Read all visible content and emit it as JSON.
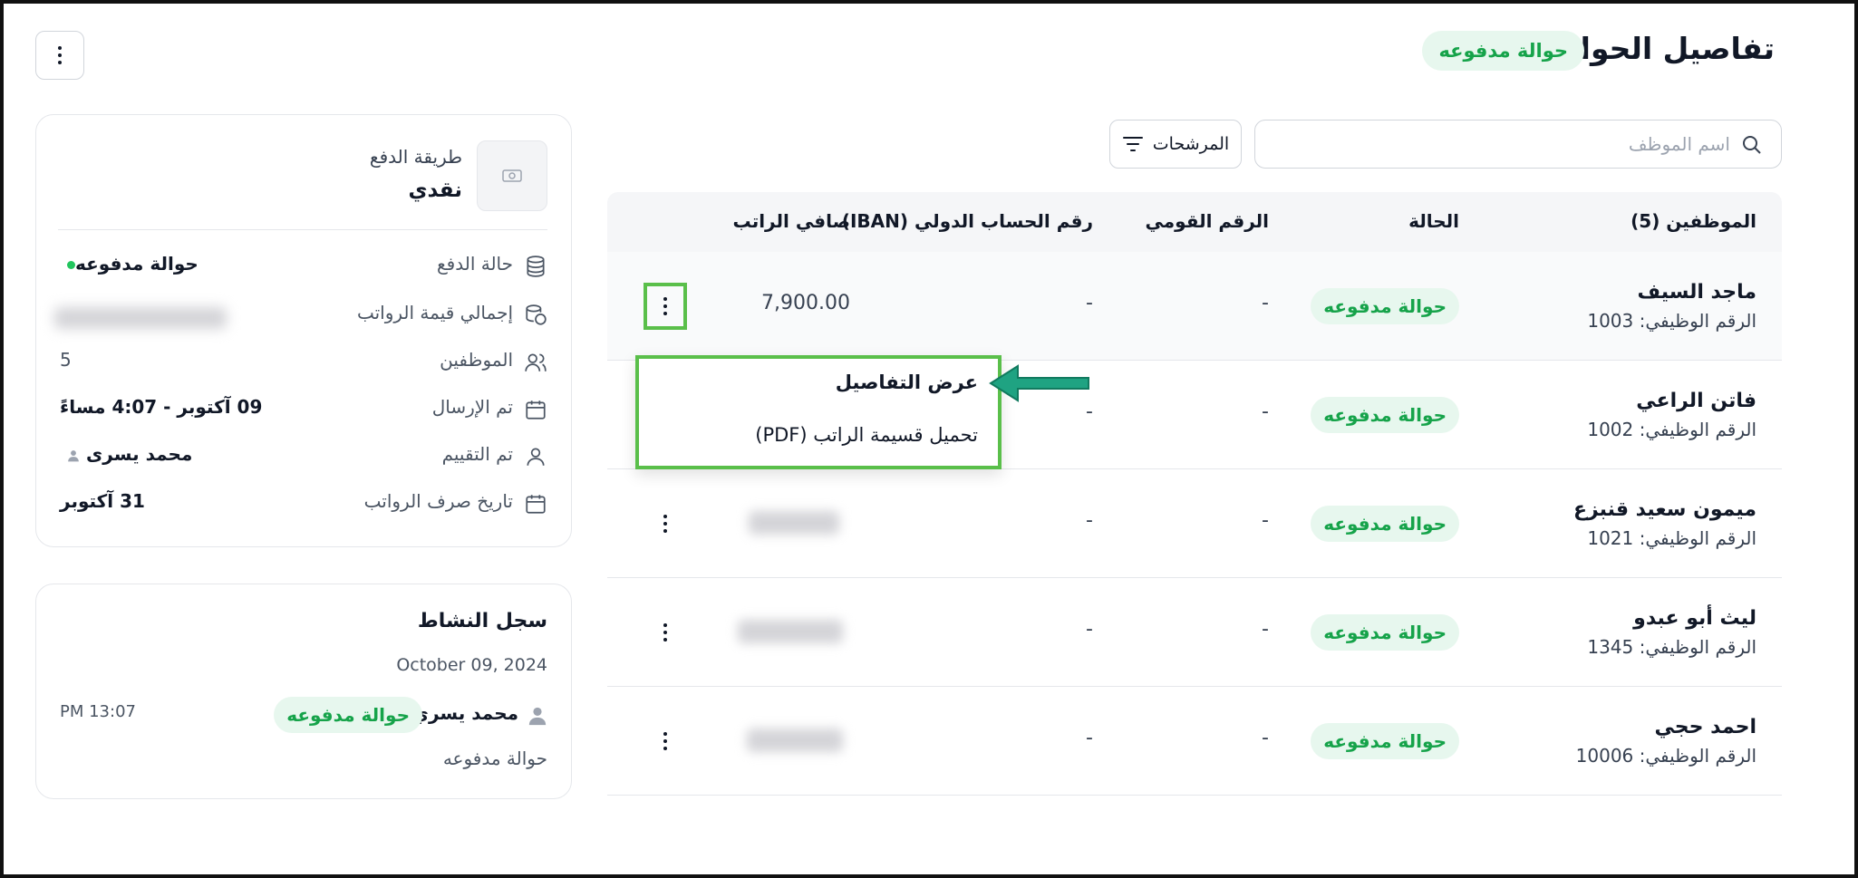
{
  "header": {
    "title": "تفاصيل الحوالة",
    "status_badge": "حوالة مدفوعه",
    "more_icon": "vertical-ellipsis-icon"
  },
  "toolbar": {
    "search_placeholder": "اسم الموظف",
    "search_value": "",
    "filter_label": "المرشحات",
    "search_icon": "search-icon",
    "filter_icon": "filter-icon"
  },
  "table": {
    "headers": {
      "employees": "الموظفين (5)",
      "status": "الحالة",
      "national_id": "الرقم القومي",
      "iban": "رقم الحساب الدولي (IBAN)",
      "net_salary": "صافي الراتب"
    },
    "rows": [
      {
        "name": "ماجد السيف",
        "job_id": "الرقم الوظيفي: 1003",
        "status": "حوالة مدفوعه",
        "national_id": "-",
        "iban": "-",
        "net_salary": "7,900.00"
      },
      {
        "name": "فاتن الراعي",
        "job_id": "الرقم الوظيفي: 1002",
        "status": "حوالة مدفوعه",
        "national_id": "-",
        "iban": "-",
        "net_salary": ""
      },
      {
        "name": "ميمون سعيد قنبزع",
        "job_id": "الرقم الوظيفي: 1021",
        "status": "حوالة مدفوعه",
        "national_id": "-",
        "iban": "-",
        "net_salary": ""
      },
      {
        "name": "ليث أبو عبدو",
        "job_id": "الرقم الوظيفي: 1345",
        "status": "حوالة مدفوعه",
        "national_id": "-",
        "iban": "-",
        "net_salary": ""
      },
      {
        "name": "احمد حجي",
        "job_id": "الرقم الوظيفي: 10006",
        "status": "حوالة مدفوعه",
        "national_id": "-",
        "iban": "-",
        "net_salary": ""
      }
    ]
  },
  "row_menu": {
    "items": [
      "عرض التفاصيل",
      "تحميل قسيمة الراتب (PDF)"
    ]
  },
  "summary": {
    "payment_method_label": "طريقة الدفع",
    "payment_method_value": "نقدي",
    "payment_status_label": "حالة الدفع",
    "payment_status_value": "حوالة مدفوعه",
    "total_salaries_label": "إجمالي قيمة الرواتب",
    "employees_label": "الموظفين",
    "employees_value": "5",
    "sent_label": "تم الإرسال",
    "sent_value": "09 آكتوبر - 4:07 مساءً",
    "reviewed_label": "تم التقييم",
    "reviewed_value": "محمد يسرى",
    "payroll_date_label": "تاريخ صرف الرواتب",
    "payroll_date_value": "31 آكتوبر"
  },
  "activity_log": {
    "title": "سجل النشاط",
    "date": "October 09, 2024",
    "user": "محمد يسري",
    "badge": "حوالة مدفوعه",
    "time": "PM 13:07",
    "description": "حوالة مدفوعه"
  },
  "colors": {
    "accent_green": "#16a34a",
    "badge_bg": "#e7f7ee",
    "annotation_green": "#5abf4a",
    "arrow_teal": "#1fa382"
  }
}
